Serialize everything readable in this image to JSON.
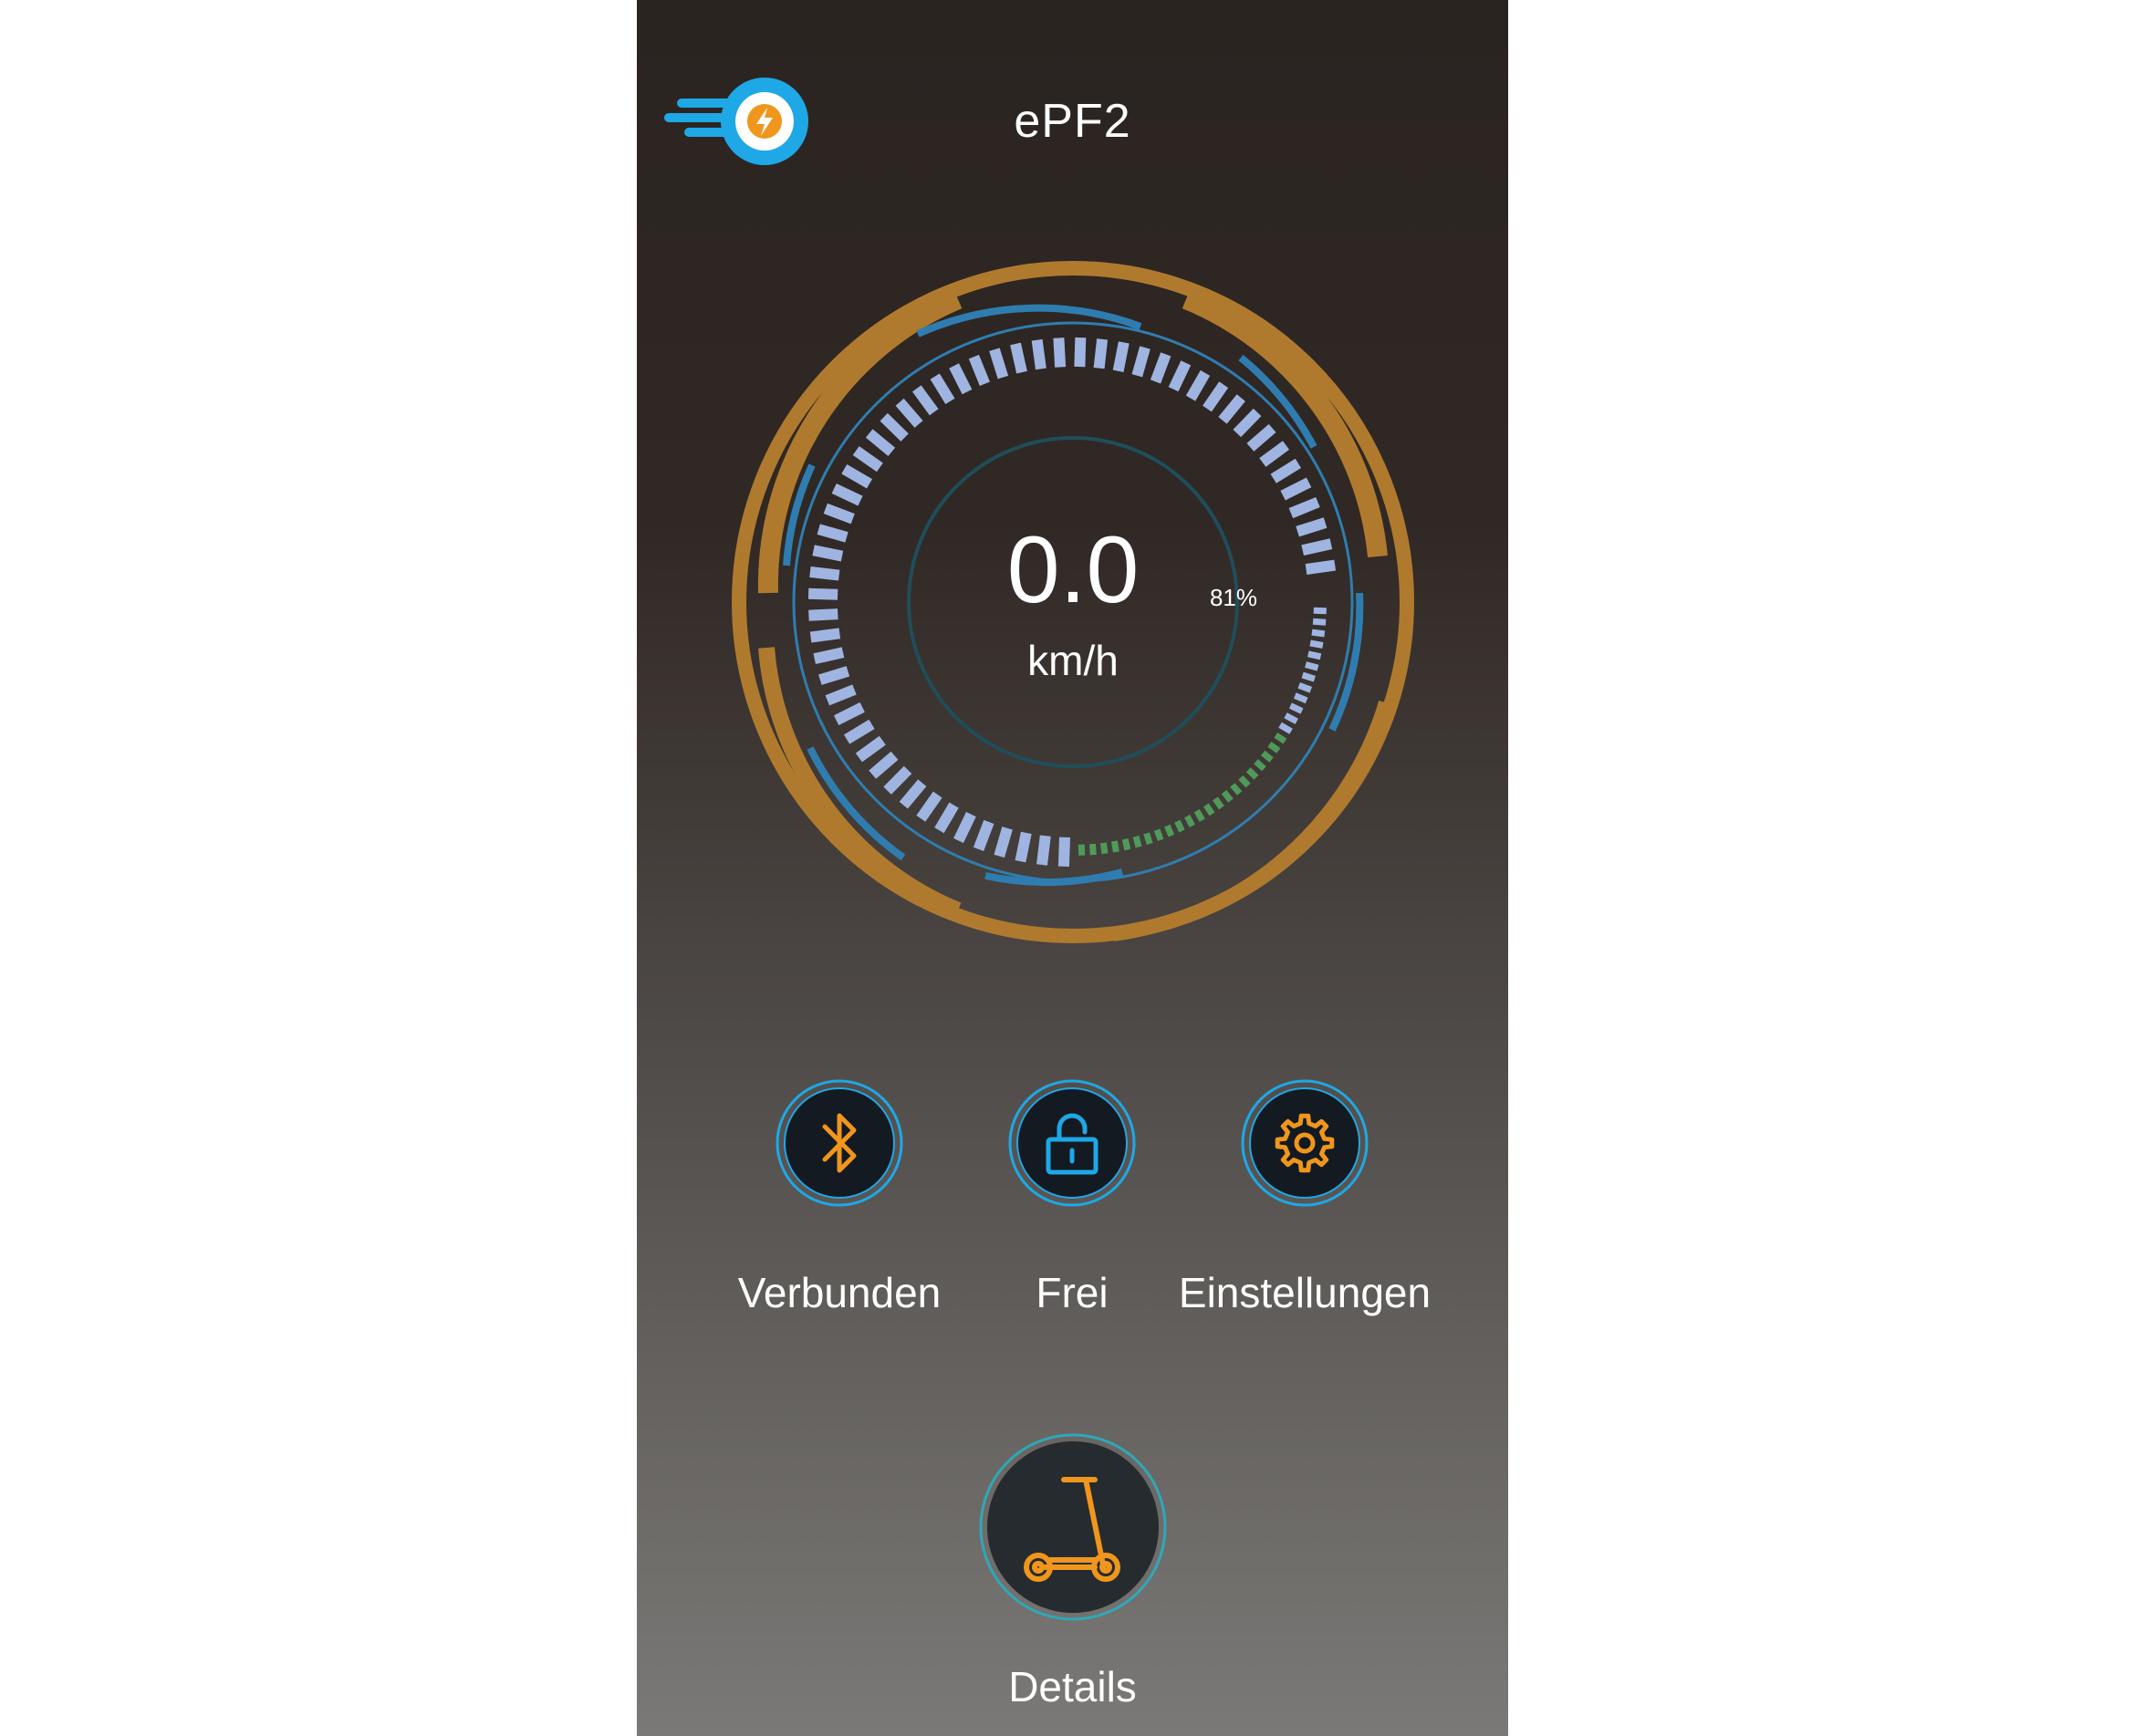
{
  "header": {
    "title": "ePF2",
    "logo_icon": "speed-bolt-logo-icon"
  },
  "speedometer": {
    "speed_value": "0.0",
    "speed_unit": "km/h",
    "battery_percent_label": "81%",
    "battery_level": 0.81,
    "speed_level": 0.0,
    "colors": {
      "frame": "#b07a2e",
      "ring": "#2f7db0",
      "ticks": "#9fb4e0",
      "battery": "#4f9a5a",
      "inner_ring": "#1f4e5a"
    }
  },
  "controls": [
    {
      "icon": "bluetooth-icon",
      "label": "Verbunden"
    },
    {
      "icon": "unlock-icon",
      "label": "Frei"
    },
    {
      "icon": "gear-icon",
      "label": "Einstellungen"
    }
  ],
  "details": {
    "icon": "scooter-icon",
    "label": "Details"
  },
  "colors": {
    "accent_orange": "#f0961c",
    "accent_blue": "#1ea8e6",
    "button_fill": "#141a22"
  }
}
